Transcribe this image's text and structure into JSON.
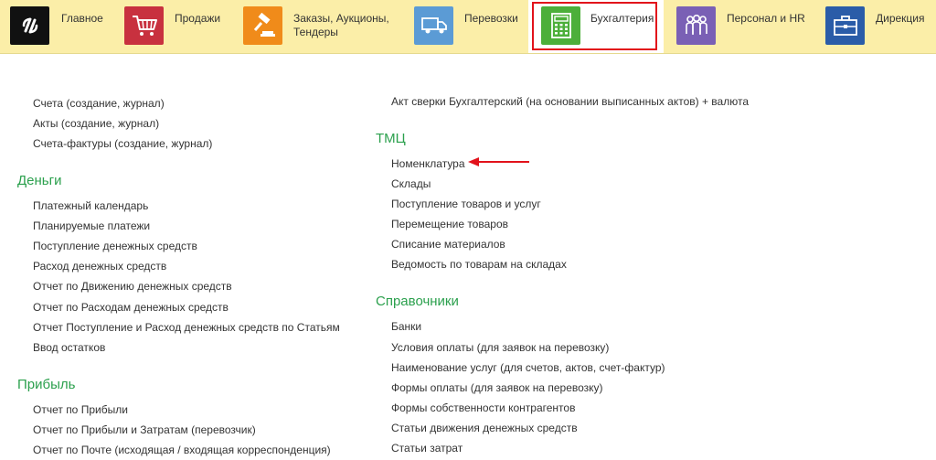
{
  "nav": {
    "items": [
      {
        "label": "Главное",
        "color": "#111111"
      },
      {
        "label": "Продажи",
        "color": "#c8313f"
      },
      {
        "label": "Заказы,  Аукционы, Тендеры",
        "color": "#f08b1a"
      },
      {
        "label": "Перевозки",
        "color": "#5b9bd5"
      },
      {
        "label": "Бухгалтерия",
        "color": "#4caf3a"
      },
      {
        "label": "Персонал и HR",
        "color": "#7a60b5"
      },
      {
        "label": "Дирекция",
        "color": "#2a5ca8"
      }
    ],
    "active_index": 4,
    "highlight_color": "#e2121b"
  },
  "left": {
    "docs": [
      "Счета (создание, журнал)",
      "Акты (создание, журнал)",
      "Счета-фактуры (создание, журнал)"
    ],
    "money_title": "Деньги",
    "money": [
      "Платежный календарь",
      "Планируемые платежи",
      "Поступление денежных средств",
      "Расход денежных средств",
      "Отчет по Движению денежных средств",
      "Отчет по Расходам денежных средств",
      "Отчет Поступление и Расход денежных средств по Статьям",
      "Ввод остатков"
    ],
    "profit_title": "Прибыль",
    "profit": [
      "Отчет по Прибыли",
      "Отчет по Прибыли и Затратам (перевозчик)",
      "Отчет по Почте (исходящая / входящая корреспонденция)"
    ]
  },
  "right": {
    "top": [
      "Акт сверки Бухгалтерский (на основании выписанных актов) + валюта"
    ],
    "tmc_title": "ТМЦ",
    "tmc": [
      "Номенклатура",
      "Склады",
      "Поступление товаров и услуг",
      "Перемещение товаров",
      "Списание материалов",
      "Ведомость по товарам на складах"
    ],
    "ref_title": "Справочники",
    "ref": [
      "Банки",
      "Условия оплаты (для заявок на перевозку)",
      "Наименование услуг (для счетов, актов, счет-фактур)",
      "Формы оплаты (для заявок на перевозку)",
      "Формы собственности контрагентов",
      "Статьи движения денежных средств",
      "Статьи затрат"
    ]
  },
  "section_color": "#2ba04d",
  "arrow_color": "#e2121b"
}
